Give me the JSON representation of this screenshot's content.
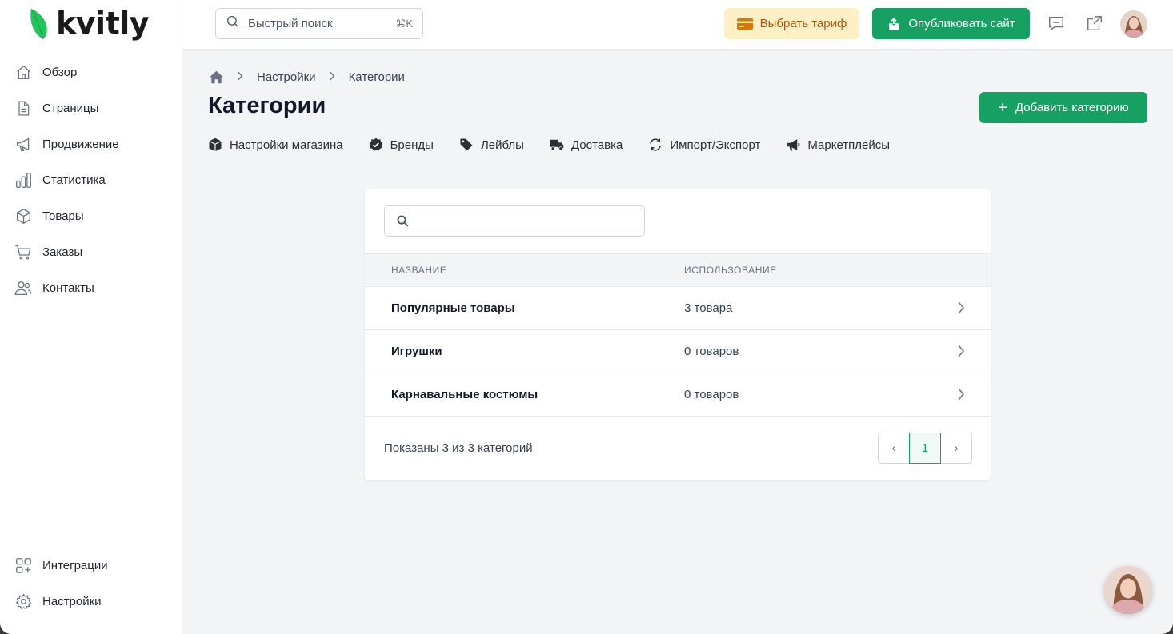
{
  "brand": {
    "name": "kvitly",
    "accent": "#16a163",
    "leaf_color": "#22c55e"
  },
  "sidebar": {
    "items": [
      {
        "label": "Обзор",
        "icon": "home-icon"
      },
      {
        "label": "Страницы",
        "icon": "file-icon"
      },
      {
        "label": "Продвижение",
        "icon": "megaphone-icon"
      },
      {
        "label": "Статистика",
        "icon": "bar-chart-icon"
      },
      {
        "label": "Товары",
        "icon": "box-icon"
      },
      {
        "label": "Заказы",
        "icon": "cart-icon"
      },
      {
        "label": "Контакты",
        "icon": "users-icon"
      }
    ],
    "bottom_items": [
      {
        "label": "Интеграции",
        "icon": "integrations-icon"
      },
      {
        "label": "Настройки",
        "icon": "gear-icon"
      }
    ]
  },
  "topbar": {
    "search_placeholder": "Быстрый поиск",
    "search_shortcut": "⌘K",
    "tariff_label": "Выбрать тариф",
    "publish_label": "Опубликовать сайт"
  },
  "breadcrumb": {
    "items": [
      "Настройки",
      "Категории"
    ]
  },
  "page": {
    "title": "Категории",
    "add_button": "Добавить категорию"
  },
  "subnav": {
    "items": [
      {
        "label": "Настройки магазина",
        "icon": "store-box-icon"
      },
      {
        "label": "Бренды",
        "icon": "badge-check-icon"
      },
      {
        "label": "Лейблы",
        "icon": "tag-icon"
      },
      {
        "label": "Доставка",
        "icon": "truck-icon"
      },
      {
        "label": "Импорт/Экспорт",
        "icon": "sync-icon"
      },
      {
        "label": "Маркетплейсы",
        "icon": "megaphone-filled-icon"
      }
    ]
  },
  "table": {
    "headers": {
      "name": "НАЗВАНИЕ",
      "usage": "ИСПОЛЬЗОВАНИЕ"
    },
    "rows": [
      {
        "name": "Популярные товары",
        "usage": "3 товара"
      },
      {
        "name": "Игрушки",
        "usage": "0 товаров"
      },
      {
        "name": "Карнавальные костюмы",
        "usage": "0 товаров"
      }
    ],
    "footer": "Показаны 3 из 3 категорий",
    "pagination": {
      "prev": "‹",
      "current": "1",
      "next": "›"
    }
  }
}
